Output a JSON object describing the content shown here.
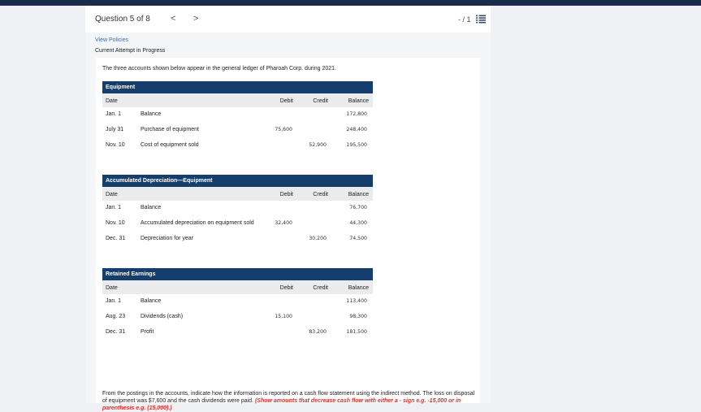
{
  "header": {
    "question_label": "Question 5 of 8",
    "prev_icon": "chevron-left-icon",
    "prev_glyph": "<",
    "next_icon": "chevron-right-icon",
    "next_glyph": ">",
    "score": "- / 1",
    "menu_icon": "list-icon"
  },
  "panel": {
    "view_policies": "View Policies",
    "attempt_status": "Current Attempt in Progress"
  },
  "content": {
    "intro": "The three accounts shown below appear in the general ledger of Pharoah Corp. during 2021.",
    "columns": {
      "date": "Date",
      "debit": "Debit",
      "credit": "Credit",
      "balance": "Balance"
    },
    "ledgers": [
      {
        "title": "Equipment",
        "rows": [
          {
            "date": "Jan. 1",
            "desc": "Balance",
            "debit": "",
            "credit": "",
            "balance": "172,800"
          },
          {
            "date": "July 31",
            "desc": "Purchase of equipment",
            "debit": "75,600",
            "credit": "",
            "balance": "248,400"
          },
          {
            "date": "Nov. 10",
            "desc": "Cost of equipment sold",
            "debit": "",
            "credit": "52,900",
            "balance": "195,500"
          }
        ]
      },
      {
        "title": "Accumulated Depreciation—Equipment",
        "rows": [
          {
            "date": "Jan. 1",
            "desc": "Balance",
            "debit": "",
            "credit": "",
            "balance": "76,700"
          },
          {
            "date": "Nov. 10",
            "desc": "Accumulated depreciation on equipment sold",
            "debit": "32,400",
            "credit": "",
            "balance": "44,300"
          },
          {
            "date": "Dec. 31",
            "desc": "Depreciation for year",
            "debit": "",
            "credit": "30,200",
            "balance": "74,500"
          }
        ]
      },
      {
        "title": "Retained Earnings",
        "rows": [
          {
            "date": "Jan. 1",
            "desc": "Balance",
            "debit": "",
            "credit": "",
            "balance": "113,400"
          },
          {
            "date": "Aug. 23",
            "desc": "Dividends (cash)",
            "debit": "15,100",
            "credit": "",
            "balance": "98,300"
          },
          {
            "date": "Dec. 31",
            "desc": "Profit",
            "debit": "",
            "credit": "83,200",
            "balance": "181,500"
          }
        ]
      }
    ],
    "instructions_text": "From the postings in the accounts, indicate how the information is reported on a cash flow statement using the indirect method. The loss on disposal of equipment was $7,600 and the cash dividends were paid.",
    "instructions_hint": "(Show amounts that decrease cash flow with either a - sign e.g. -15,000 or in parenthesis e.g. (15,000).)"
  }
}
